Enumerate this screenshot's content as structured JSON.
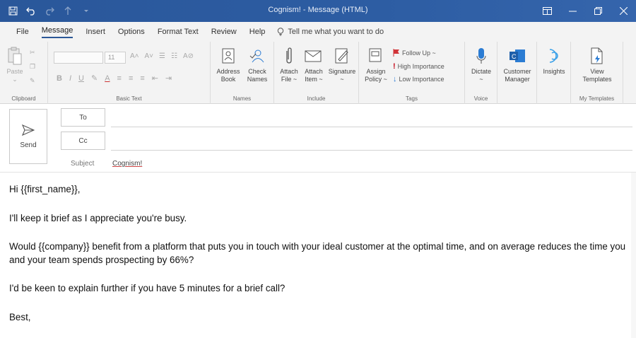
{
  "window": {
    "title": "Cognism! - Message (HTML)",
    "qat": [
      "save-icon",
      "undo-icon",
      "redo-icon",
      "up-arrow-icon",
      "customize-icon"
    ]
  },
  "tabs": [
    {
      "label": "File"
    },
    {
      "label": "Message"
    },
    {
      "label": "Insert"
    },
    {
      "label": "Options"
    },
    {
      "label": "Format Text"
    },
    {
      "label": "Review"
    },
    {
      "label": "Help"
    }
  ],
  "tell_me": "Tell me what you want to do",
  "ribbon": {
    "clipboard": {
      "paste": "Paste",
      "label": "Clipboard"
    },
    "basic_text": {
      "font_size": "11",
      "label": "Basic Text"
    },
    "names": {
      "address_book": [
        "Address",
        "Book"
      ],
      "check_names": [
        "Check",
        "Names"
      ],
      "label": "Names"
    },
    "include": {
      "attach_file": [
        "Attach",
        "File ~"
      ],
      "attach_item": [
        "Attach",
        "Item ~"
      ],
      "signature": [
        "Signature",
        "~"
      ],
      "label": "Include"
    },
    "tags": {
      "assign_policy": [
        "Assign",
        "Policy ~"
      ],
      "follow_up": "Follow Up ~",
      "high_importance": "High Importance",
      "low_importance": "Low Importance",
      "label": "Tags"
    },
    "voice": {
      "dictate": [
        "Dictate",
        "~"
      ],
      "label": "Voice"
    },
    "customer_manager": [
      "Customer",
      "Manager"
    ],
    "insights": "Insights",
    "my_templates": {
      "view_templates": [
        "View",
        "Templates"
      ],
      "label": "My Templates"
    }
  },
  "compose": {
    "send": "Send",
    "to": "To",
    "cc": "Cc",
    "subject_label": "Subject",
    "subject_value": "Cognism!"
  },
  "body": {
    "greeting": "Hi {{first_name}},",
    "p1": "I'll keep it brief as I appreciate you're busy.",
    "p2": "Would {{company}} benefit from a platform that puts you in touch with your ideal customer at the optimal time, and on average reduces the time you and your team spends prospecting by 66%?",
    "p3": "I'd be keen to explain further if you have 5 minutes for a brief call?",
    "signoff": "Best,"
  },
  "colors": {
    "titlebar": "#2b5797",
    "ribbon": "#f3f3f3",
    "flag": "#d13438",
    "importance": "#c50f1f",
    "low": "#2b7cd3"
  }
}
